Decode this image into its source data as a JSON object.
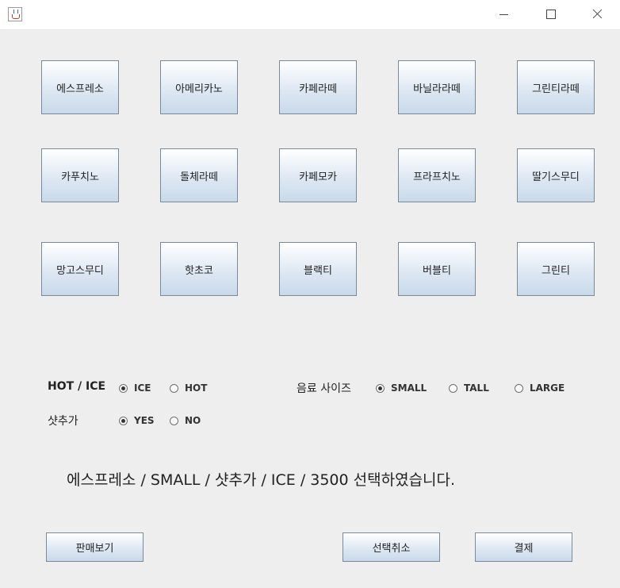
{
  "menu": [
    [
      "에스프레소",
      "아메리카노",
      "카페라떼",
      "바닐라라떼",
      "그린티라떼"
    ],
    [
      "카푸치노",
      "돌체라떼",
      "카페모카",
      "프라프치노",
      "딸기스무디"
    ],
    [
      "망고스무디",
      "핫초코",
      "블랙티",
      "버블티",
      "그린티"
    ]
  ],
  "options": {
    "temp_label": "HOT / ICE",
    "temp": [
      {
        "label": "ICE",
        "selected": true
      },
      {
        "label": "HOT",
        "selected": false
      }
    ],
    "size_label": "음료 사이즈",
    "size": [
      {
        "label": "SMALL",
        "selected": true
      },
      {
        "label": "TALL",
        "selected": false
      },
      {
        "label": "LARGE",
        "selected": false
      }
    ],
    "shot_label": "샷추가",
    "shot": [
      {
        "label": "YES",
        "selected": true
      },
      {
        "label": "NO",
        "selected": false
      }
    ]
  },
  "summary": "에스프레소 / SMALL / 샷추가 / ICE / 3500 선택하였습니다.",
  "actions": {
    "sales": "판매보기",
    "cancel": "선택취소",
    "pay": "결제"
  }
}
